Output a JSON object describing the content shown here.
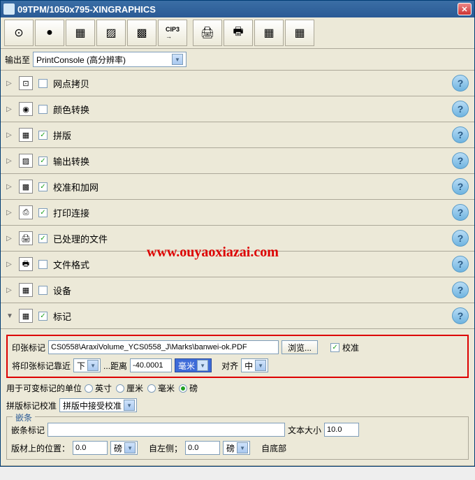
{
  "titlebar": {
    "text": "09TPM/1050x795-XINGRAPHICS"
  },
  "output": {
    "label": "输出至",
    "value": "PrintConsole (高分辨率)"
  },
  "sections": [
    {
      "label": "网点拷贝",
      "checked": false,
      "icon": "⊡"
    },
    {
      "label": "颜色转换",
      "checked": false,
      "icon": "◉"
    },
    {
      "label": "拼版",
      "checked": true,
      "icon": "▦"
    },
    {
      "label": "输出转换",
      "checked": true,
      "icon": "▨"
    },
    {
      "label": "校准和加网",
      "checked": true,
      "icon": "▩"
    },
    {
      "label": "打印连接",
      "checked": true,
      "icon": "⎙"
    },
    {
      "label": "已处理的文件",
      "checked": true,
      "icon": "🖨"
    },
    {
      "label": "文件格式",
      "checked": false,
      "icon": "🖶"
    },
    {
      "label": "设备",
      "checked": false,
      "icon": "▦"
    },
    {
      "label": "标记",
      "checked": true,
      "icon": "▦",
      "expanded": true
    }
  ],
  "marks": {
    "sheetMarkLabel": "印张标记",
    "sheetMarkPath": "CS0558\\AraxiVolume_YCS0558_J\\Marks\\banwei-ok.PDF",
    "browseLabel": "浏览...",
    "calibrateLabel": "校准",
    "alignLabel": "将印张标记靠近",
    "alignValue": "下",
    "distanceLabel": "...距离",
    "distanceValue": "-40.0001",
    "unitValue": "毫米",
    "justifyLabel": "对齐",
    "justifyValue": "中",
    "varUnitLabel": "用于可变标记的单位",
    "radios": [
      "英寸",
      "厘米",
      "毫米",
      "磅"
    ],
    "radioSelected": 3,
    "panelCalibLabel": "拼版标记校准",
    "panelCalibValue": "拼版中接受校准",
    "inset": {
      "legend": "嵌条",
      "markLabel": "嵌条标记",
      "markValue": "",
      "textSizeLabel": "文本大小",
      "textSizeValue": "10.0",
      "posLabel": "版材上的位置：",
      "posValue": "0.0",
      "posUnit": "磅",
      "fromLeftLabel": "自左侧；",
      "fromLeftValue": "0.0",
      "fromLeftUnit": "磅",
      "fromBottomLabel": "自底部"
    }
  },
  "watermark": "www.ouyaoxiazai.com"
}
